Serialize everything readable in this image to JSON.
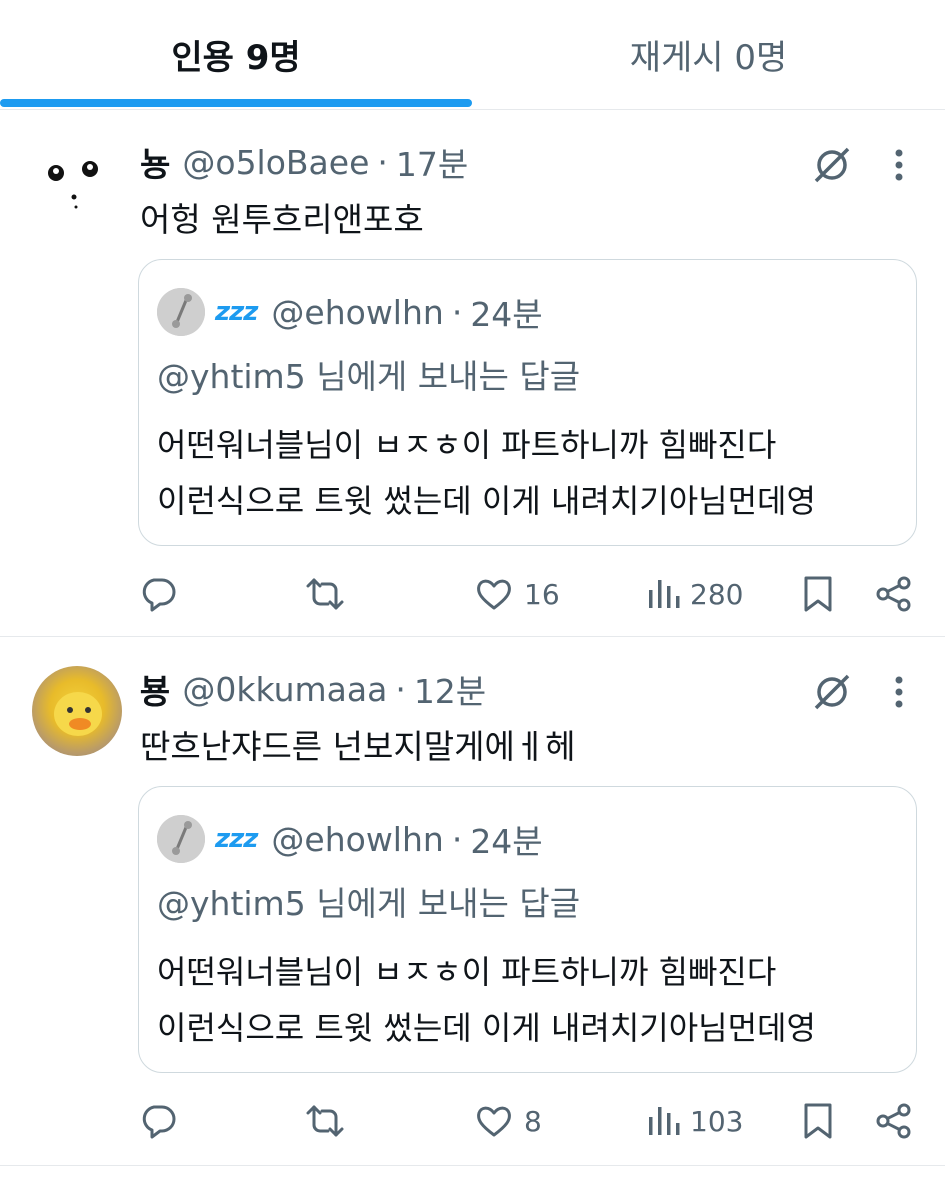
{
  "tabs": {
    "quotes": "인용 9명",
    "reposts": "재게시 0명"
  },
  "posts": [
    {
      "display_name": "뇽",
      "handle": "@o5loBaee",
      "separator": "·",
      "time": "17분",
      "text": "어헝 원투흐리앤포호",
      "quote": {
        "zzz": "zzz",
        "handle": "@ehowlhn",
        "separator": "·",
        "time": "24분",
        "reply_mention": "@yhtim5",
        "reply_suffix": " 님에게 보내는 답글",
        "line1": "어떤워너블님이 ㅂㅈㅎ이 파트하니까 힘빠진다",
        "line2": "이런식으로 트윗 썼는데 이게 내려치기아님먼데영"
      },
      "likes": "16",
      "views": "280"
    },
    {
      "display_name": "뵹",
      "handle": "@0kkumaaa",
      "separator": "·",
      "time": "12분",
      "text": "딴흐난쟈드른 넌보지말게에ㅔ헤",
      "quote": {
        "zzz": "zzz",
        "handle": "@ehowlhn",
        "separator": "·",
        "time": "24분",
        "reply_mention": "@yhtim5",
        "reply_suffix": " 님에게 보내는 답글",
        "line1": "어떤워너블님이 ㅂㅈㅎ이 파트하니까 힘빠진다",
        "line2": "이런식으로 트윗 썼는데 이게 내려치기아님먼데영"
      },
      "likes": "8",
      "views": "103"
    }
  ],
  "colors": {
    "accent": "#1d9bf0",
    "text": "#0f1419",
    "muted": "#536471",
    "border": "#cfd9de"
  },
  "icons": [
    "reply-icon",
    "repost-icon",
    "heart-icon",
    "views-icon",
    "bookmark-icon",
    "share-icon",
    "grok-icon",
    "more-icon"
  ]
}
